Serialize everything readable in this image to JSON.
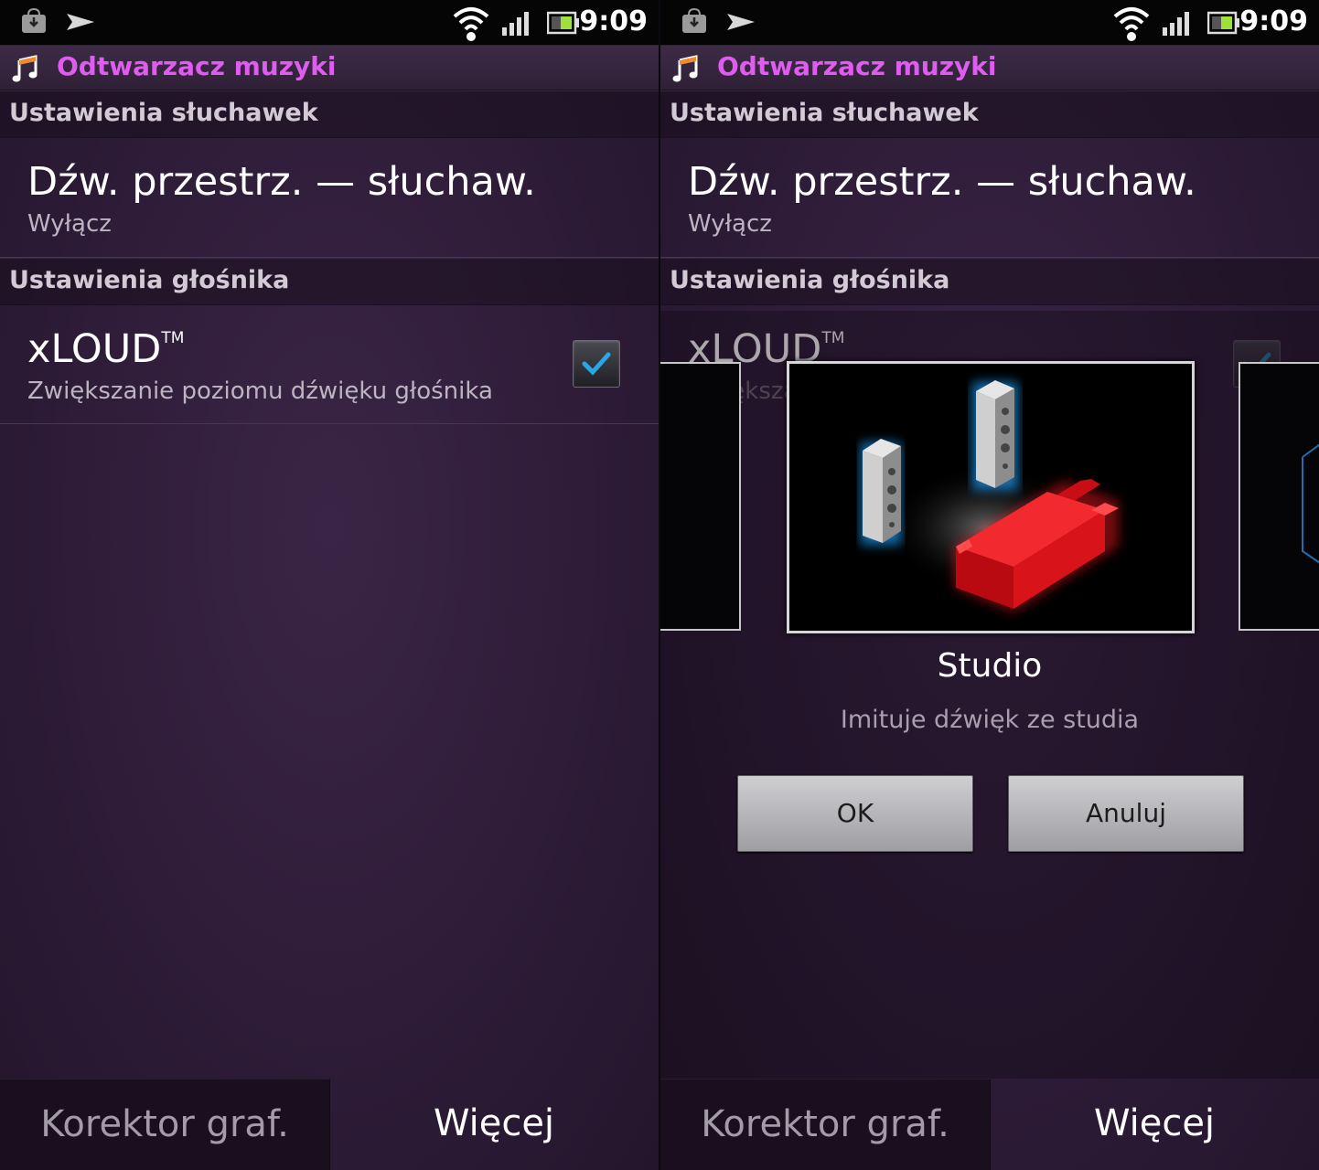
{
  "app_title": "Odtwarzacz muzyki",
  "status": {
    "time": "9:09"
  },
  "sections": {
    "headphones": "Ustawienia słuchawek",
    "speaker": "Ustawienia głośnika"
  },
  "surround": {
    "title": "Dźw. przestrz. — słuchaw.",
    "value": "Wyłącz"
  },
  "xloud": {
    "title": "xLOUD",
    "tm": "TM",
    "subtitle": "Zwiększanie poziomu dźwięku głośnika",
    "subtitle_clipped": "Zwiększa",
    "checked": true
  },
  "bottom": {
    "equalizer": "Korektor graf.",
    "more": "Więcej"
  },
  "dialog": {
    "mode_name": "Studio",
    "mode_description": "Imituje dźwięk ze studia",
    "ok": "OK",
    "cancel": "Anuluj"
  },
  "colors": {
    "title_accent": "#e05cf0",
    "check_accent": "#2aa6e6",
    "sofa": "#e8121a"
  },
  "icons": [
    "download-icon",
    "play-icon",
    "wifi-icon",
    "signal-icon",
    "battery-icon",
    "music-note-icon",
    "checkmark-icon"
  ]
}
